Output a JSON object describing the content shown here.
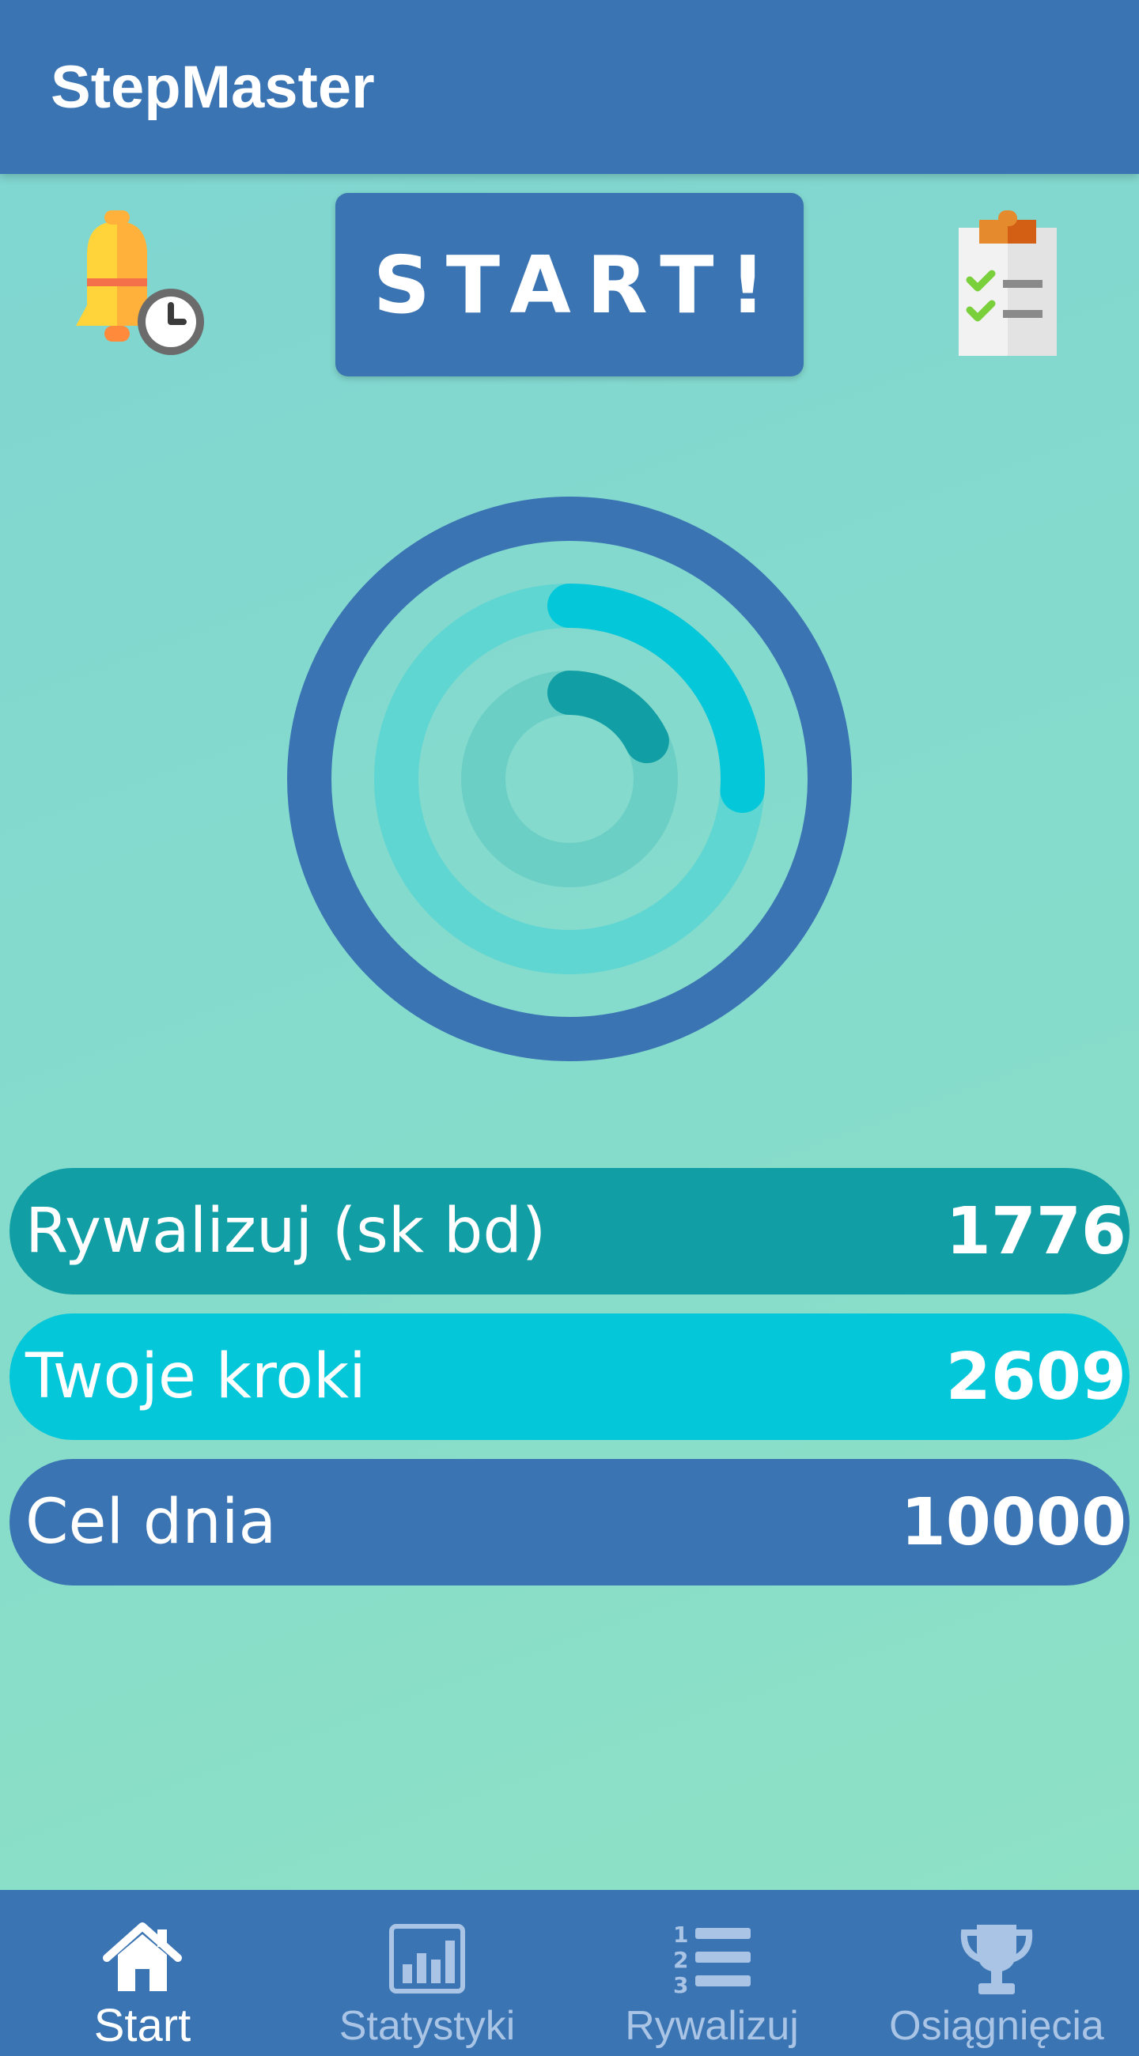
{
  "app": {
    "title": "StepMaster"
  },
  "toolbar": {
    "start_label": "START!",
    "reminder_icon": "bell-clock-icon",
    "tasks_icon": "clipboard-checklist-icon"
  },
  "progress": {
    "compete_fraction": 0.1776,
    "steps_fraction": 0.2609,
    "colors": {
      "outer_ring": "#3a74b3",
      "middle_track": "#5fd6d2",
      "middle_progress": "#04c7d9",
      "inner_track": "#6ccfc6",
      "inner_progress": "#119ea4"
    }
  },
  "stats": [
    {
      "label": "Rywalizuj (sk bd)",
      "value": "1776",
      "color": "#119ea4"
    },
    {
      "label": "Twoje kroki",
      "value": "2609",
      "color": "#04c7d9"
    },
    {
      "label": "Cel dnia",
      "value": "10000",
      "color": "#3a74b3"
    }
  ],
  "nav": [
    {
      "label": "Start",
      "icon": "home-icon",
      "active": true
    },
    {
      "label": "Statystyki",
      "icon": "bar-chart-icon",
      "active": false
    },
    {
      "label": "Rywalizuj",
      "icon": "ranking-list-icon",
      "active": false
    },
    {
      "label": "Osiągnięcia",
      "icon": "trophy-icon",
      "active": false
    }
  ],
  "colors": {
    "primary": "#3a74b3",
    "teal": "#119ea4",
    "cyan": "#04c7d9",
    "nav_inactive": "#a9c4e4"
  }
}
